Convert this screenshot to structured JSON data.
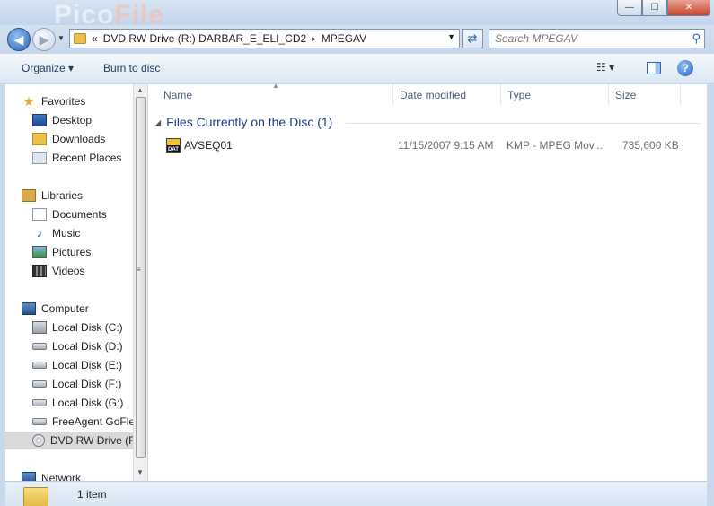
{
  "window": {
    "ghost_title_a": "Pico",
    "ghost_title_b": "File",
    "buttons": {
      "minimize": "—",
      "maximize": "☐",
      "close": "✕"
    }
  },
  "address": {
    "overflow": "«",
    "crumbs": [
      "DVD RW Drive (R:) DARBAR_E_ELI_CD2",
      "MPEGAV"
    ],
    "separator": "▸",
    "search_placeholder": "Search MPEGAV"
  },
  "toolbar": {
    "organize": "Organize ▾",
    "burn": "Burn to disc",
    "views_icon": "☷ ▾",
    "help": "?"
  },
  "nav": {
    "favorites": {
      "label": "Favorites",
      "items": [
        {
          "label": "Desktop",
          "icon": "desktop-icon"
        },
        {
          "label": "Downloads",
          "icon": "downloads-icon"
        },
        {
          "label": "Recent Places",
          "icon": "recent-places-icon"
        }
      ]
    },
    "libraries": {
      "label": "Libraries",
      "items": [
        {
          "label": "Documents",
          "icon": "documents-icon"
        },
        {
          "label": "Music",
          "icon": "music-icon"
        },
        {
          "label": "Pictures",
          "icon": "pictures-icon"
        },
        {
          "label": "Videos",
          "icon": "videos-icon"
        }
      ]
    },
    "computer": {
      "label": "Computer",
      "items": [
        {
          "label": "Local Disk (C:)"
        },
        {
          "label": "Local Disk (D:)"
        },
        {
          "label": "Local Disk (E:)"
        },
        {
          "label": "Local Disk (F:)"
        },
        {
          "label": "Local Disk (G:)"
        },
        {
          "label": "FreeAgent GoFlex"
        },
        {
          "label": "DVD RW Drive (R"
        }
      ]
    },
    "network": {
      "label": "Network"
    }
  },
  "columns": {
    "name": "Name",
    "date": "Date modified",
    "type": "Type",
    "size": "Size"
  },
  "group": {
    "label": "Files Currently on the Disc (1)"
  },
  "files": [
    {
      "icon_text": "DAT",
      "name": "AVSEQ01",
      "date": "11/15/2007 9:15 AM",
      "type": "KMP - MPEG Mov...",
      "size": "735,600 KB"
    }
  ],
  "status": {
    "count": "1 item"
  },
  "colors": {
    "accent": "#1e3a87",
    "chrome": "#c9d9ec",
    "selected": "#d9d9d9"
  }
}
